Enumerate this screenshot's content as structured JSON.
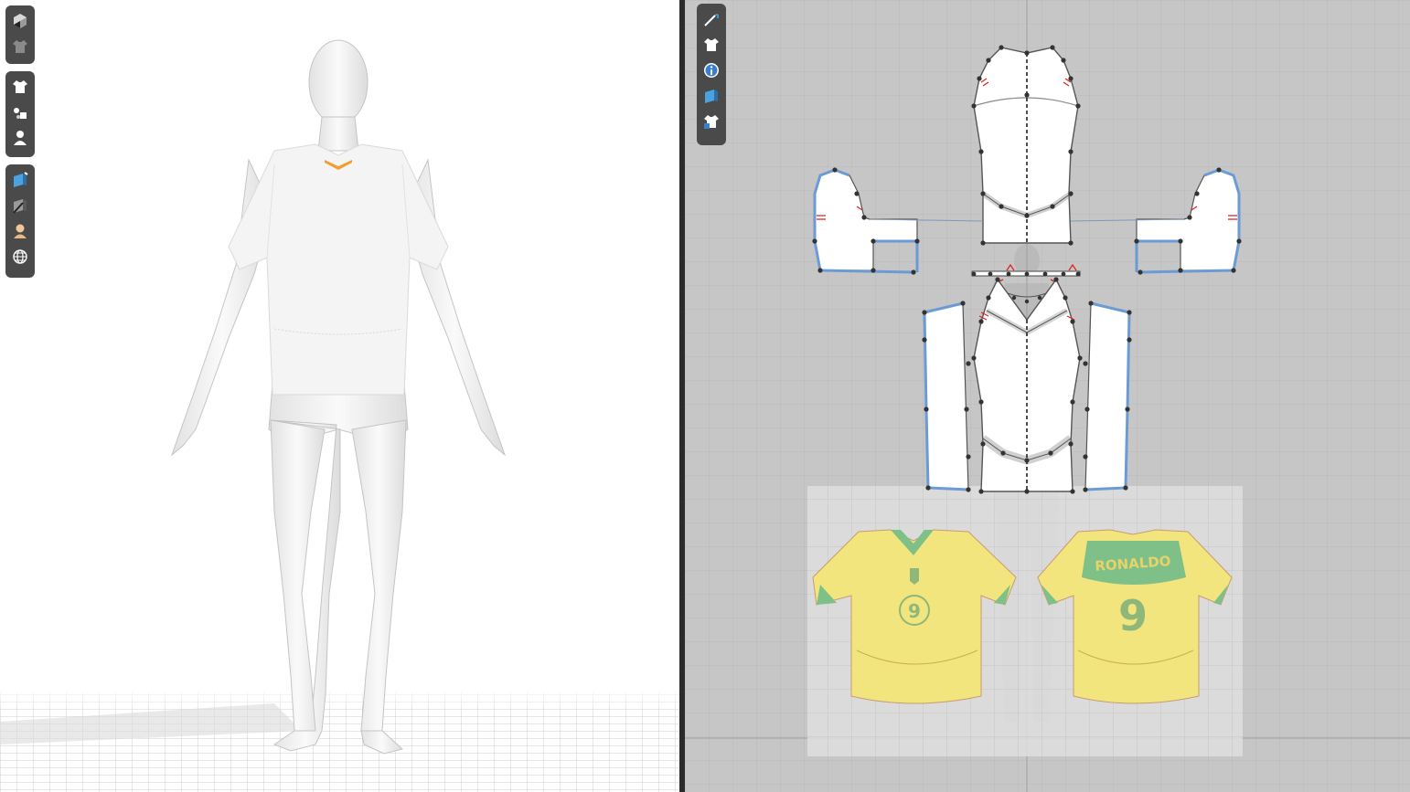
{
  "viewport_3d": {
    "toolbar_groups": [
      [
        "display-mode-icon",
        "garment-view-icon"
      ],
      [
        "shirt-icon",
        "texture-view-icon",
        "avatar-icon"
      ],
      [
        "3d-pen-icon",
        "render-icon",
        "skin-tone-icon",
        "globe-icon"
      ]
    ]
  },
  "viewport_2d": {
    "toolbar": [
      "edit-pattern-icon",
      "shirt-icon",
      "info-icon",
      "3d-pen-icon",
      "garment-lock-icon"
    ],
    "reference_image": {
      "back_name": "RONALDO",
      "front_number": "9",
      "back_number": "9"
    }
  },
  "colors": {
    "workspace_3d": "#ffffff",
    "workspace_2d": "#c6c6c6",
    "toolbar": "#4a4a4a",
    "pattern_outline_selected": "#6b9bd6",
    "notch_marks": "#dd2222",
    "jersey_yellow": "#f2e57d",
    "jersey_green": "#7fbf88",
    "collar_highlight": "#f0a030"
  }
}
